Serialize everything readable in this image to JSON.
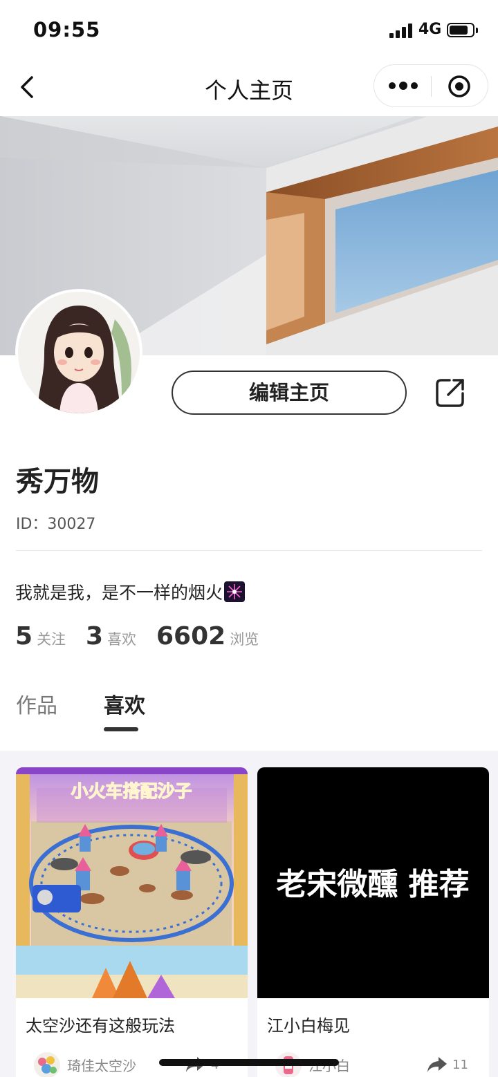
{
  "status_bar": {
    "time": "09:55",
    "network": "4G"
  },
  "nav": {
    "title": "个人主页"
  },
  "profile": {
    "edit_label": "编辑主页",
    "name": "秀万物",
    "id_text": "ID：30027",
    "bio": "我就是我，是不一样的烟火",
    "stats": [
      {
        "value": "5",
        "label": "关注"
      },
      {
        "value": "3",
        "label": "喜欢"
      },
      {
        "value": "6602",
        "label": "浏览"
      }
    ]
  },
  "tabs": [
    {
      "label": "作品",
      "active": false
    },
    {
      "label": "喜欢",
      "active": true
    }
  ],
  "cards": [
    {
      "thumb_text": "小火车搭配沙子",
      "title": "太空沙还有这般玩法",
      "author": "琦佳太空沙",
      "share_count": "4"
    },
    {
      "thumb_text": "老宋微醺 推荐",
      "title": "江小白梅见",
      "author": "江小白",
      "share_count": "11"
    }
  ]
}
